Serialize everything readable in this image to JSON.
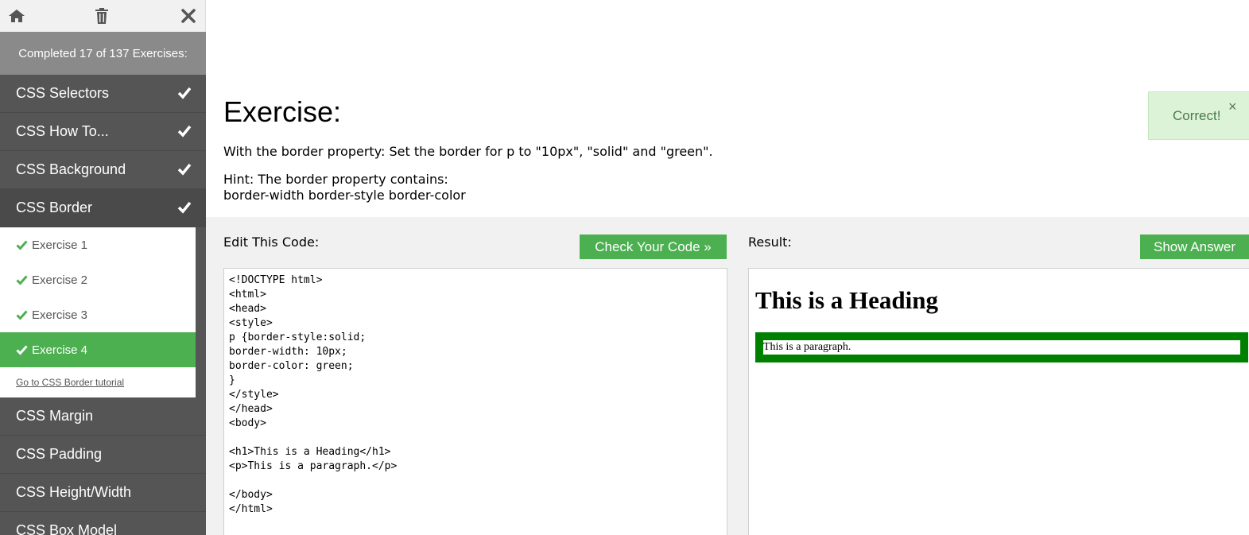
{
  "sidebar": {
    "toolbar": {
      "home_icon": "home-icon",
      "trash_icon": "trash-icon",
      "close_icon": "close-icon"
    },
    "progress": "Completed 17 of 137 Exercises:",
    "categories_top": [
      {
        "label": "CSS Selectors",
        "done": true
      },
      {
        "label": "CSS How To...",
        "done": true
      },
      {
        "label": "CSS Background",
        "done": true
      },
      {
        "label": "CSS Border",
        "done": true
      }
    ],
    "exercises": [
      {
        "label": "Exercise 1"
      },
      {
        "label": "Exercise 2"
      },
      {
        "label": "Exercise 3"
      },
      {
        "label": "Exercise 4"
      }
    ],
    "tutorial_link": "Go to CSS Border tutorial",
    "categories_bottom": [
      {
        "label": "CSS Margin"
      },
      {
        "label": "CSS Padding"
      },
      {
        "label": "CSS Height/Width"
      },
      {
        "label": "CSS Box Model"
      }
    ]
  },
  "exercise": {
    "title": "Exercise:",
    "instruction": "With the border property: Set the border for p to \"10px\", \"solid\" and \"green\".",
    "hint_line1": "Hint: The border property contains:",
    "hint_line2": "border-width border-style border-color"
  },
  "toast": {
    "message": "Correct!",
    "close": "×"
  },
  "workspace": {
    "edit_label": "Edit This Code:",
    "check_button": "Check Your Code »",
    "result_label": "Result:",
    "show_button": "Show Answer",
    "code": "<!DOCTYPE html>\n<html>\n<head>\n<style>\np {border-style:solid;\nborder-width: 10px;\nborder-color: green;\n}\n</style>\n</head>\n<body>\n\n<h1>This is a Heading</h1>\n<p>This is a paragraph.</p>\n\n</body>\n</html>",
    "result_heading": "This is a Heading",
    "result_paragraph": "This is a paragraph."
  },
  "colors": {
    "accent": "#4caf50",
    "sidebar": "#555555",
    "toast_bg": "#ddf3d8"
  }
}
